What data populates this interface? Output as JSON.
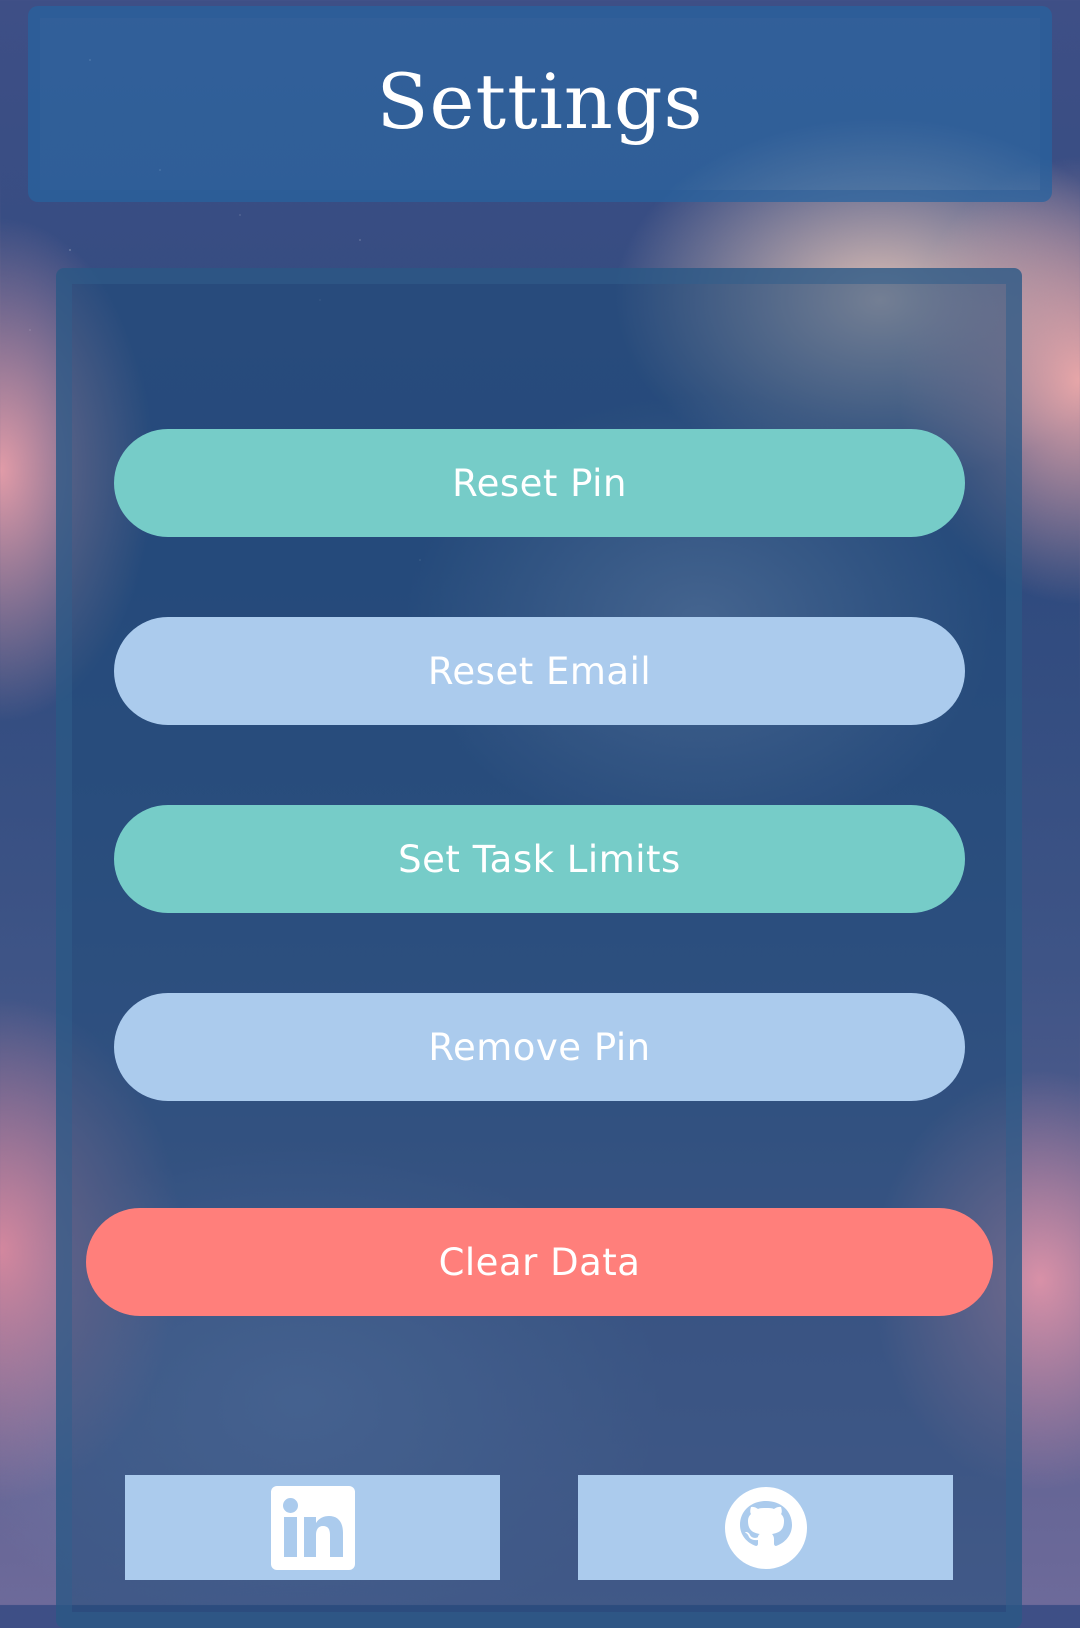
{
  "header": {
    "title": "Settings"
  },
  "settings": {
    "reset_pin": "Reset Pin",
    "reset_email": "Reset Email",
    "set_task_limits": "Set Task Limits",
    "remove_pin": "Remove Pin",
    "clear_data": "Clear Data"
  },
  "colors": {
    "teal_button": "#76ccc8",
    "blue_button": "#abcbed",
    "danger_button": "#ff7f7b",
    "text": "#ffffff"
  },
  "footer": {
    "icons": [
      "linkedin-icon",
      "github-icon"
    ]
  }
}
